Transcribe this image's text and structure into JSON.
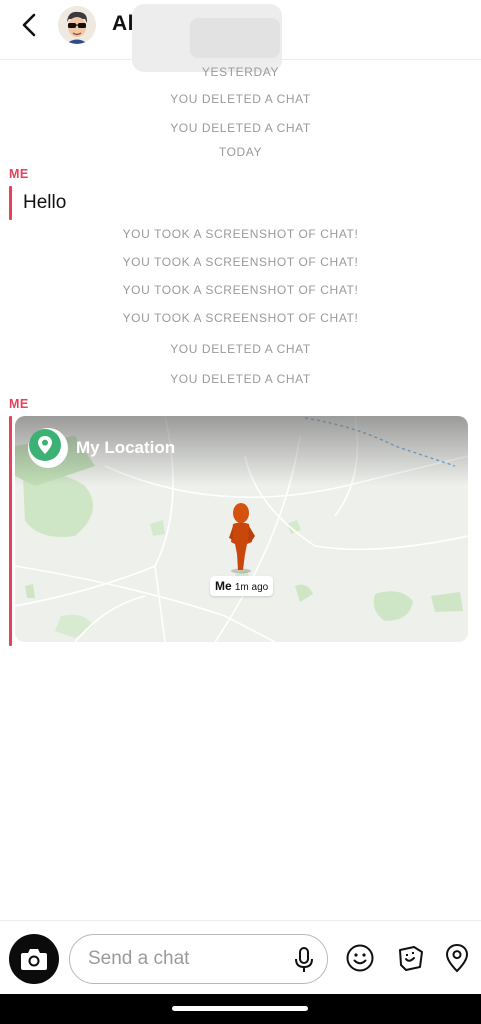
{
  "header": {
    "contact_name": "Al",
    "back_icon": "chevron-left-icon",
    "avatar_icon": "bitmoji-avatar-icon"
  },
  "chat": {
    "sys_yesterday": "YESTERDAY",
    "sys_deleted_1": "YOU DELETED A CHAT",
    "sys_deleted_2": "YOU DELETED A CHAT",
    "sys_today": "TODAY",
    "sender_1": "ME",
    "message_1": "Hello",
    "sys_screenshot_1": "YOU TOOK A SCREENSHOT OF CHAT!",
    "sys_screenshot_2": "YOU TOOK A SCREENSHOT OF CHAT!",
    "sys_screenshot_3": "YOU TOOK A SCREENSHOT OF CHAT!",
    "sys_screenshot_4": "YOU TOOK A SCREENSHOT OF CHAT!",
    "sys_deleted_3": "YOU DELETED A CHAT",
    "sys_deleted_4": "YOU DELETED A CHAT",
    "sender_2": "ME",
    "location_card": {
      "title": "My Location",
      "pin_label": "Me",
      "pin_time": "1m ago"
    }
  },
  "composer": {
    "placeholder": "Send a chat",
    "icons": [
      "camera-icon",
      "microphone-icon",
      "smiley-icon",
      "sticker-icon",
      "location-pin-icon"
    ]
  },
  "colors": {
    "accent_red": "#e8415a",
    "system_text": "#9a9a9a",
    "location_green": "#3bb273"
  }
}
